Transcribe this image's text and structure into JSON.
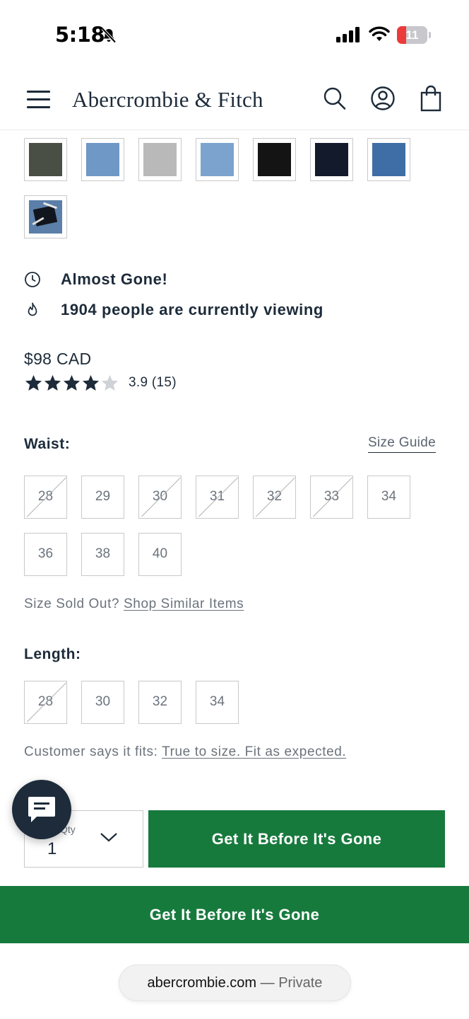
{
  "status_bar": {
    "time": "5:18",
    "battery_level": "11",
    "battery_percent": 11,
    "icons": [
      "bell-slash-icon",
      "cellular-signal-icon",
      "wifi-icon",
      "battery-icon"
    ]
  },
  "header": {
    "logo": "Abercrombie & Fitch",
    "icons": [
      "hamburger-menu-icon",
      "search-icon",
      "account-icon",
      "shopping-bag-icon"
    ]
  },
  "swatches": [
    {
      "color": "#4a4f45"
    },
    {
      "color": "#6f98c6"
    },
    {
      "color": "#b9b9b9"
    },
    {
      "color": "#7ca3cd"
    },
    {
      "color": "#141414"
    },
    {
      "color": "#121a2c"
    },
    {
      "color": "#3f6da5"
    },
    {
      "color": "#1c2a40"
    }
  ],
  "notices": {
    "almost_gone": "Almost Gone!",
    "viewers": "1904 people are currently viewing"
  },
  "product": {
    "price": "$98 CAD",
    "rating": 3.9,
    "rating_text": "3.9 (15)",
    "stars_total": 5
  },
  "waist": {
    "label": "Waist:",
    "size_guide": "Size Guide",
    "sizes": [
      {
        "value": "28",
        "sold_out": true
      },
      {
        "value": "29",
        "sold_out": false
      },
      {
        "value": "30",
        "sold_out": true
      },
      {
        "value": "31",
        "sold_out": true
      },
      {
        "value": "32",
        "sold_out": true
      },
      {
        "value": "33",
        "sold_out": true
      },
      {
        "value": "34",
        "sold_out": false
      },
      {
        "value": "36",
        "sold_out": false
      },
      {
        "value": "38",
        "sold_out": false
      },
      {
        "value": "40",
        "sold_out": false
      }
    ]
  },
  "size_sold_out": {
    "text": "Size Sold Out?",
    "link": "Shop Similar Items"
  },
  "length": {
    "label": "Length:",
    "sizes": [
      {
        "value": "28",
        "sold_out": true
      },
      {
        "value": "30",
        "sold_out": false
      },
      {
        "value": "32",
        "sold_out": false
      },
      {
        "value": "34",
        "sold_out": false
      }
    ]
  },
  "fit": {
    "text": "Customer says it fits:",
    "link": "True to size. Fit as expected."
  },
  "purchase": {
    "qty_label": "Qty",
    "qty_value": "1",
    "cta_label": "Get It Before It's Gone",
    "sticky_cta_label": "Get It Before It's Gone",
    "cta_color": "#177a3d"
  },
  "browser": {
    "domain": "abercrombie.com",
    "separator": "—",
    "mode": "Private"
  }
}
